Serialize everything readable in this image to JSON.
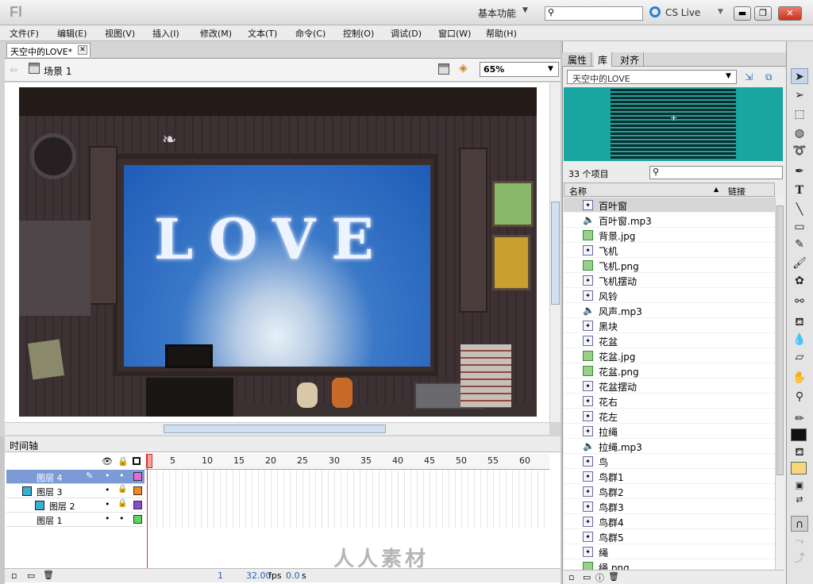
{
  "app": {
    "logo": "Fl",
    "workspace": "基本功能",
    "cs_live": "CS Live"
  },
  "menu": [
    "文件(F)",
    "编辑(E)",
    "视图(V)",
    "插入(I)",
    "修改(M)",
    "文本(T)",
    "命令(C)",
    "控制(O)",
    "调试(D)",
    "窗口(W)",
    "帮助(H)"
  ],
  "document": {
    "tab": "天空中的LOVE*",
    "scene": "场景 1",
    "zoom": "65%",
    "stage_text": "LOVE"
  },
  "timeline": {
    "title": "时间轴",
    "frame_numbers": [
      "1",
      "5",
      "10",
      "15",
      "20",
      "25",
      "30",
      "35",
      "40",
      "45",
      "50",
      "55",
      "60"
    ],
    "layers": [
      {
        "name": "图层 4",
        "color": "#e46ad8"
      },
      {
        "name": "图层 3",
        "color": "#f08a24"
      },
      {
        "name": "图层 2",
        "color": "#8a4ad0"
      },
      {
        "name": "图层 1",
        "color": "#5ed65e"
      }
    ],
    "status": {
      "frame": "1",
      "fps": "32.00",
      "fps_unit": "fps",
      "time": "0.0",
      "time_unit": "s"
    }
  },
  "panel": {
    "tabs": [
      "属性",
      "库",
      "对齐"
    ],
    "active_tab": "库",
    "library_select": "天空中的LOVE",
    "item_count": "33 个项目",
    "col_name": "名称",
    "col_link": "链接",
    "items": [
      {
        "name": "百叶窗",
        "type": "movie"
      },
      {
        "name": "百叶窗.mp3",
        "type": "sound"
      },
      {
        "name": "背景.jpg",
        "type": "bitmap"
      },
      {
        "name": "飞机",
        "type": "movie"
      },
      {
        "name": "飞机.png",
        "type": "bitmap"
      },
      {
        "name": "飞机摆动",
        "type": "movie"
      },
      {
        "name": "风铃",
        "type": "movie"
      },
      {
        "name": "风声.mp3",
        "type": "sound"
      },
      {
        "name": "黑块",
        "type": "movie"
      },
      {
        "name": "花盆",
        "type": "movie"
      },
      {
        "name": "花盆.jpg",
        "type": "bitmap"
      },
      {
        "name": "花盆.png",
        "type": "bitmap"
      },
      {
        "name": "花盆摆动",
        "type": "movie"
      },
      {
        "name": "花右",
        "type": "movie"
      },
      {
        "name": "花左",
        "type": "movie"
      },
      {
        "name": "拉绳",
        "type": "movie"
      },
      {
        "name": "拉绳.mp3",
        "type": "sound"
      },
      {
        "name": "鸟",
        "type": "movie"
      },
      {
        "name": "鸟群1",
        "type": "movie"
      },
      {
        "name": "鸟群2",
        "type": "movie"
      },
      {
        "name": "鸟群3",
        "type": "movie"
      },
      {
        "name": "鸟群4",
        "type": "movie"
      },
      {
        "name": "鸟群5",
        "type": "movie"
      },
      {
        "name": "绳",
        "type": "movie"
      },
      {
        "name": "绳.png",
        "type": "bitmap"
      }
    ]
  },
  "watermark": "人人素材",
  "colors": {
    "accent": "#7c9bd6",
    "preview_bg": "#1aa6a0"
  }
}
